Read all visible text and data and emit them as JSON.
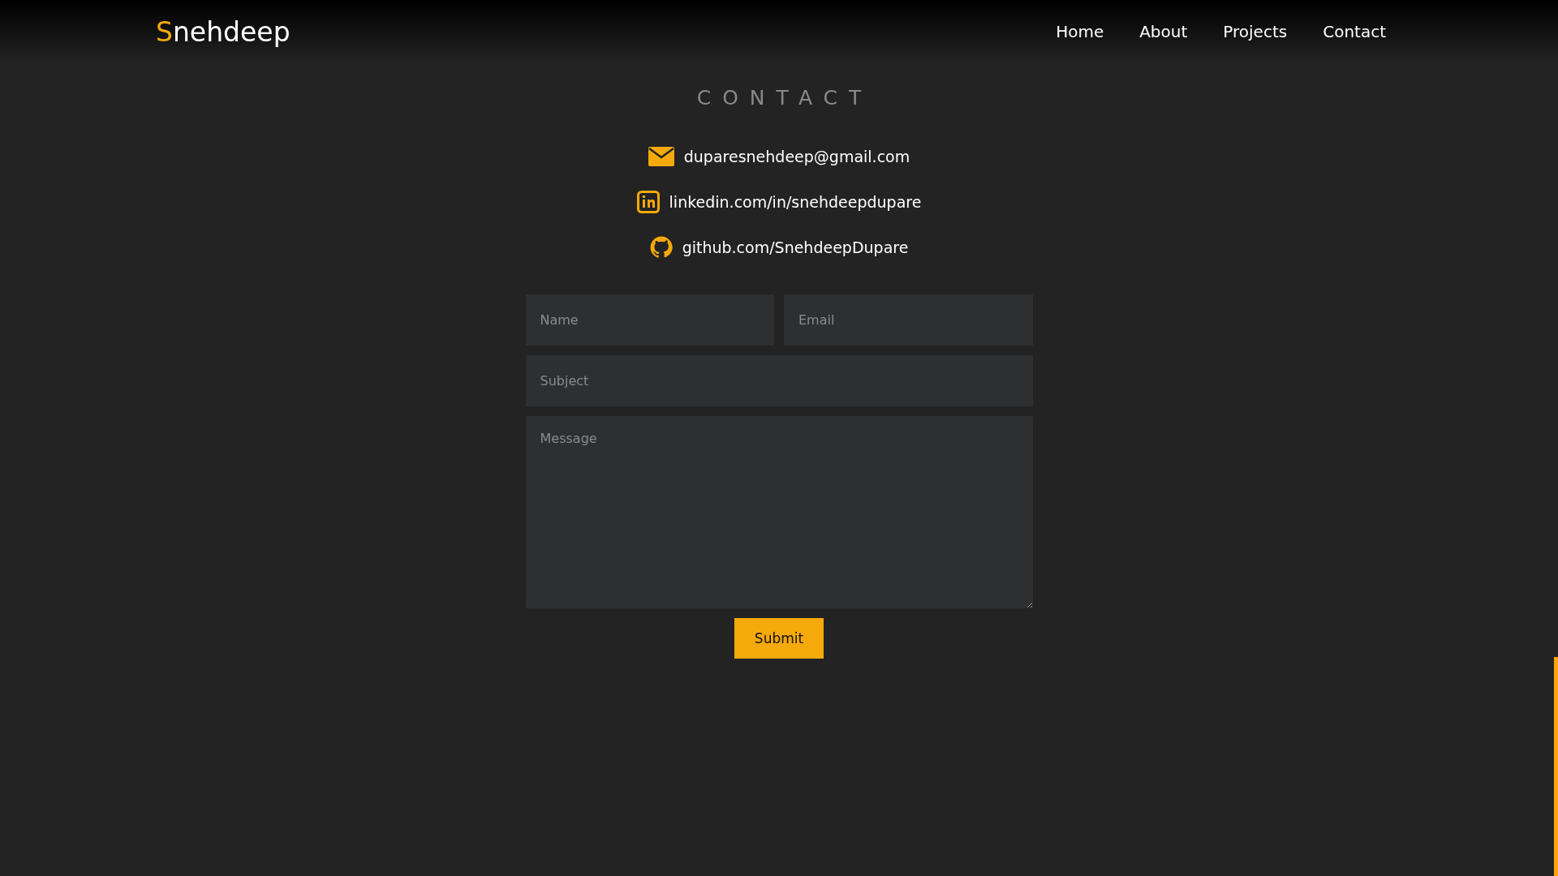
{
  "logo": {
    "initial": "S",
    "rest": "nehdeep"
  },
  "nav": [
    "Home",
    "About",
    "Projects",
    "Contact"
  ],
  "section_title": "CONTACT",
  "contacts": [
    {
      "kind": "email",
      "text": "duparesnehdeep@gmail.com"
    },
    {
      "kind": "linkedin",
      "text": "linkedin.com/in/snehdeepdupare"
    },
    {
      "kind": "github",
      "text": "github.com/SnehdeepDupare"
    }
  ],
  "form": {
    "name": {
      "placeholder": "Name"
    },
    "email": {
      "placeholder": "Email"
    },
    "subject": {
      "placeholder": "Subject"
    },
    "message": {
      "placeholder": "Message"
    },
    "submit": "Submit"
  }
}
